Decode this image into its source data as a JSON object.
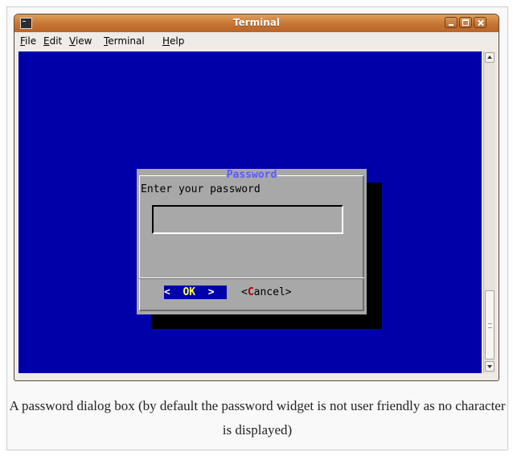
{
  "window": {
    "title": "Terminal"
  },
  "menu": {
    "file": {
      "acc": "F",
      "rest": "ile"
    },
    "edit": {
      "acc": "E",
      "rest": "dit"
    },
    "view": {
      "acc": "V",
      "rest": "iew"
    },
    "terminal": {
      "acc": "T",
      "rest": "erminal"
    },
    "help": {
      "acc": "H",
      "rest": "elp"
    }
  },
  "dialog": {
    "title": "Password",
    "prompt": "Enter your password",
    "password_value": "",
    "ok": {
      "left": "<  ",
      "label": "OK",
      "right": "  >"
    },
    "cancel": {
      "left": "<",
      "hot": "C",
      "rest": "ancel>"
    }
  },
  "caption": "A password dialog box (by default the password widget is not user friendly as no character is displayed)",
  "colors": {
    "terminal_bg": "#0000a8",
    "dialog_bg": "#a8a8a8",
    "dialog_title": "#5a5aff",
    "titlebar": "#c67432",
    "ok_label": "#ffff55",
    "cancel_hotkey": "#a80000"
  }
}
